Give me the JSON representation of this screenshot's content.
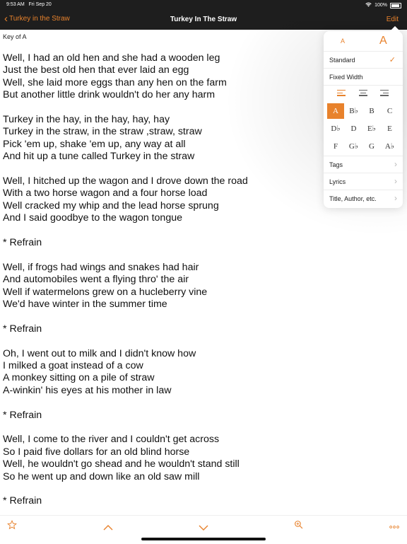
{
  "status": {
    "time": "9:53 AM",
    "date": "Fri Sep 20",
    "battery": "100%"
  },
  "nav": {
    "back_label": "Turkey in the Straw",
    "title": "Turkey In The Straw",
    "edit_label": "Edit"
  },
  "song": {
    "key_label": "Key of A",
    "blocks": [
      [
        "Well, I had an old hen and she had a wooden leg",
        "Just the best old hen that ever laid an egg",
        "Well, she laid more eggs than any hen on the farm",
        "But another little drink wouldn't do her any harm"
      ],
      [
        "Turkey in the hay, in the hay, hay, hay",
        "Turkey in the straw, in the straw ,straw, straw",
        "Pick 'em up, shake 'em up, any way at all",
        "And hit up a tune called Turkey in the straw"
      ],
      [
        "Well, I hitched up the wagon and I drove down the road",
        "With a two horse wagon and a four horse load",
        "Well cracked my whip and the lead horse sprung",
        "And I said goodbye to the wagon tongue"
      ],
      [
        "* Refrain"
      ],
      [
        "Well, if frogs had wings and snakes had hair",
        "And automobiles went a flying thro' the air",
        "Well if watermelons grew on a hucleberry vine",
        "We'd have winter in the summer time"
      ],
      [
        "* Refrain"
      ],
      [
        "Oh, I went out to milk and I didn't know how",
        "I milked a goat instead of a cow",
        "A monkey sitting on a pile of straw",
        "A-winkin' his eyes at his mother in law"
      ],
      [
        "* Refrain"
      ],
      [
        "Well, I come to the river and I couldn't get across",
        "So I paid five dollars for an old blind horse",
        "Well, he wouldn't go shead and he wouldn't stand still",
        "So he went up and down like an old saw mill"
      ],
      [
        "* Refrain"
      ]
    ]
  },
  "popover": {
    "font_small": "A",
    "font_large": "A",
    "standard_label": "Standard",
    "fixed_width_label": "Fixed Width",
    "keys": [
      [
        "A",
        "B♭",
        "B",
        "C"
      ],
      [
        "D♭",
        "D",
        "E♭",
        "E"
      ],
      [
        "F",
        "G♭",
        "G",
        "A♭"
      ]
    ],
    "selected_key": "A",
    "tags_label": "Tags",
    "lyrics_label": "Lyrics",
    "title_author_label": "Title, Author, etc."
  },
  "colors": {
    "accent": "#e8822c",
    "bar": "#1e1e1e"
  }
}
